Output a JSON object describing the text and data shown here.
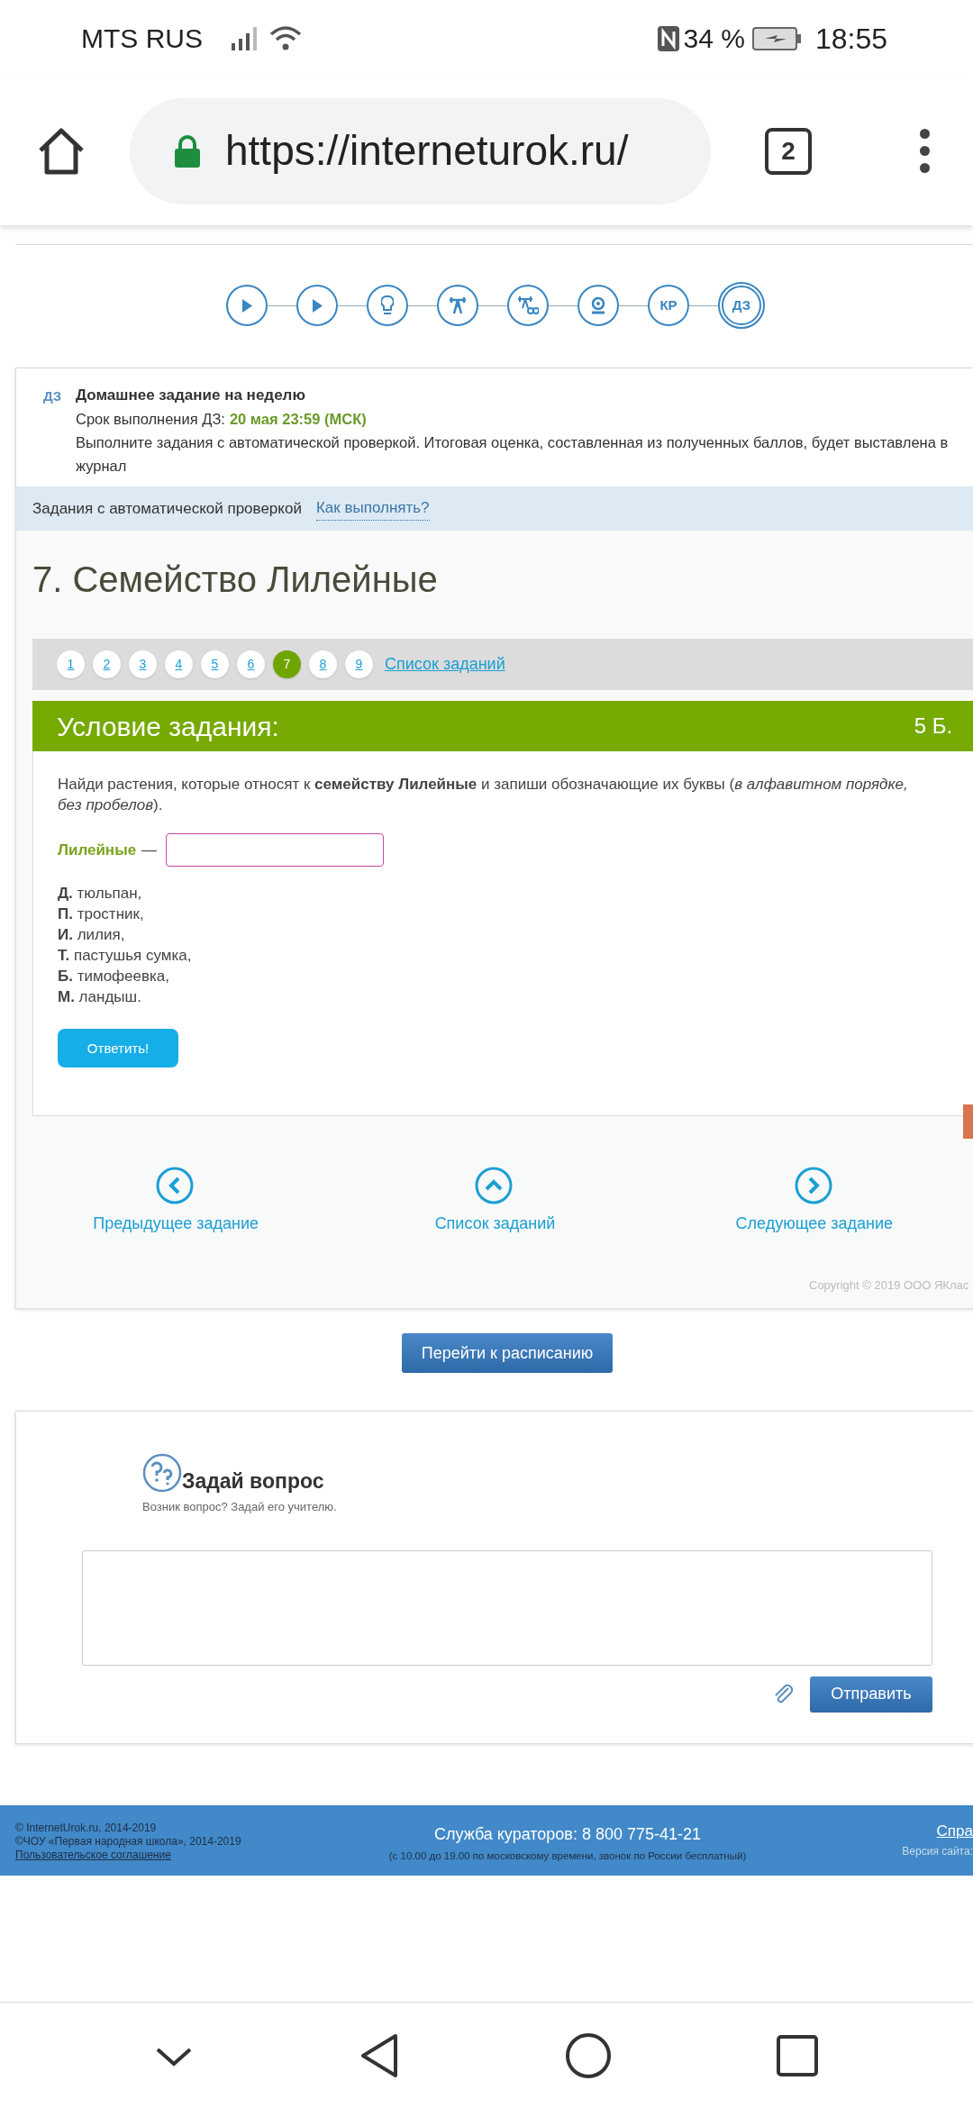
{
  "status_bar": {
    "carrier": "MTS RUS",
    "battery": "34 %",
    "time": "18:55"
  },
  "browser": {
    "url": "https://interneturok.ru/",
    "tab_count": "2"
  },
  "lesson_steps": [
    {
      "kind": "play",
      "selected": false
    },
    {
      "kind": "play",
      "selected": false
    },
    {
      "kind": "bulb",
      "selected": false
    },
    {
      "kind": "trainer",
      "selected": false
    },
    {
      "kind": "trainer-plus",
      "selected": false
    },
    {
      "kind": "webcam",
      "selected": false
    },
    {
      "kind": "text",
      "label": "КР",
      "selected": false
    },
    {
      "kind": "text",
      "label": "ДЗ",
      "selected": true
    }
  ],
  "homework": {
    "badge": "ДЗ",
    "title": "Домашнее задание на неделю",
    "deadline_label": "Срок выполнения ДЗ:",
    "deadline": "20 мая 23:59 (МСК)",
    "description": "Выполните задания с автоматической проверкой. Итоговая оценка, составленная из полученных баллов, будет выставлена в журнал"
  },
  "info_band": {
    "text": "Задания с автоматической проверкой",
    "link": "Как выполнять?"
  },
  "task_title": "7. Семейство Лилейные",
  "pagination": {
    "items": [
      {
        "label": "1",
        "selected": false
      },
      {
        "label": "2",
        "selected": false
      },
      {
        "label": "3",
        "selected": false
      },
      {
        "label": "4",
        "selected": false
      },
      {
        "label": "5",
        "selected": false
      },
      {
        "label": "6",
        "selected": false
      },
      {
        "label": "7",
        "selected": true
      },
      {
        "label": "8",
        "selected": false
      },
      {
        "label": "9",
        "selected": false
      }
    ],
    "list_link": "Список заданий"
  },
  "task": {
    "header": "Условие задания:",
    "points": "5 Б.",
    "prompt": "Найди растения, которые относят к **семейству Лилейные** и запиши обозначающие их буквы (*в алфавитном порядке, без пробелов*).",
    "answer_label": "Лилейные",
    "answer_dash": "—",
    "options": [
      "**Д.** тюльпан,",
      "**П.** тростник,",
      "**И.** лилия,",
      "**Т.** пастушья сумка,",
      "**Б.** тимофеевка,",
      "**М.** ландыш."
    ],
    "submit": "Ответить!"
  },
  "navigation": [
    {
      "kind": "prev",
      "label": "Предыдущее задание"
    },
    {
      "kind": "list",
      "label": "Список заданий"
    },
    {
      "kind": "next",
      "label": "Следующее задание"
    }
  ],
  "copyright": "Copyright © 2019 ООО ЯКлас",
  "schedule_button": "Перейти к расписанию",
  "question": {
    "title": "Задай вопрос",
    "subtitle": "Возник вопрос? Задай его учителю.",
    "send": "Отправить"
  },
  "footer": {
    "left": [
      "© InternetUrok.ru, 2014-2019",
      "©ЧОУ «Первая народная школа», 2014-2019"
    ],
    "agreement": "Пользовательское соглашение",
    "hotline": "Служба кураторов: 8 800 775-41-21",
    "hours": "(с 10.00 до 19.00 по московскому времени, звонок по России бесплатный)",
    "right_link": "Спра",
    "version": "Версия сайта:"
  }
}
